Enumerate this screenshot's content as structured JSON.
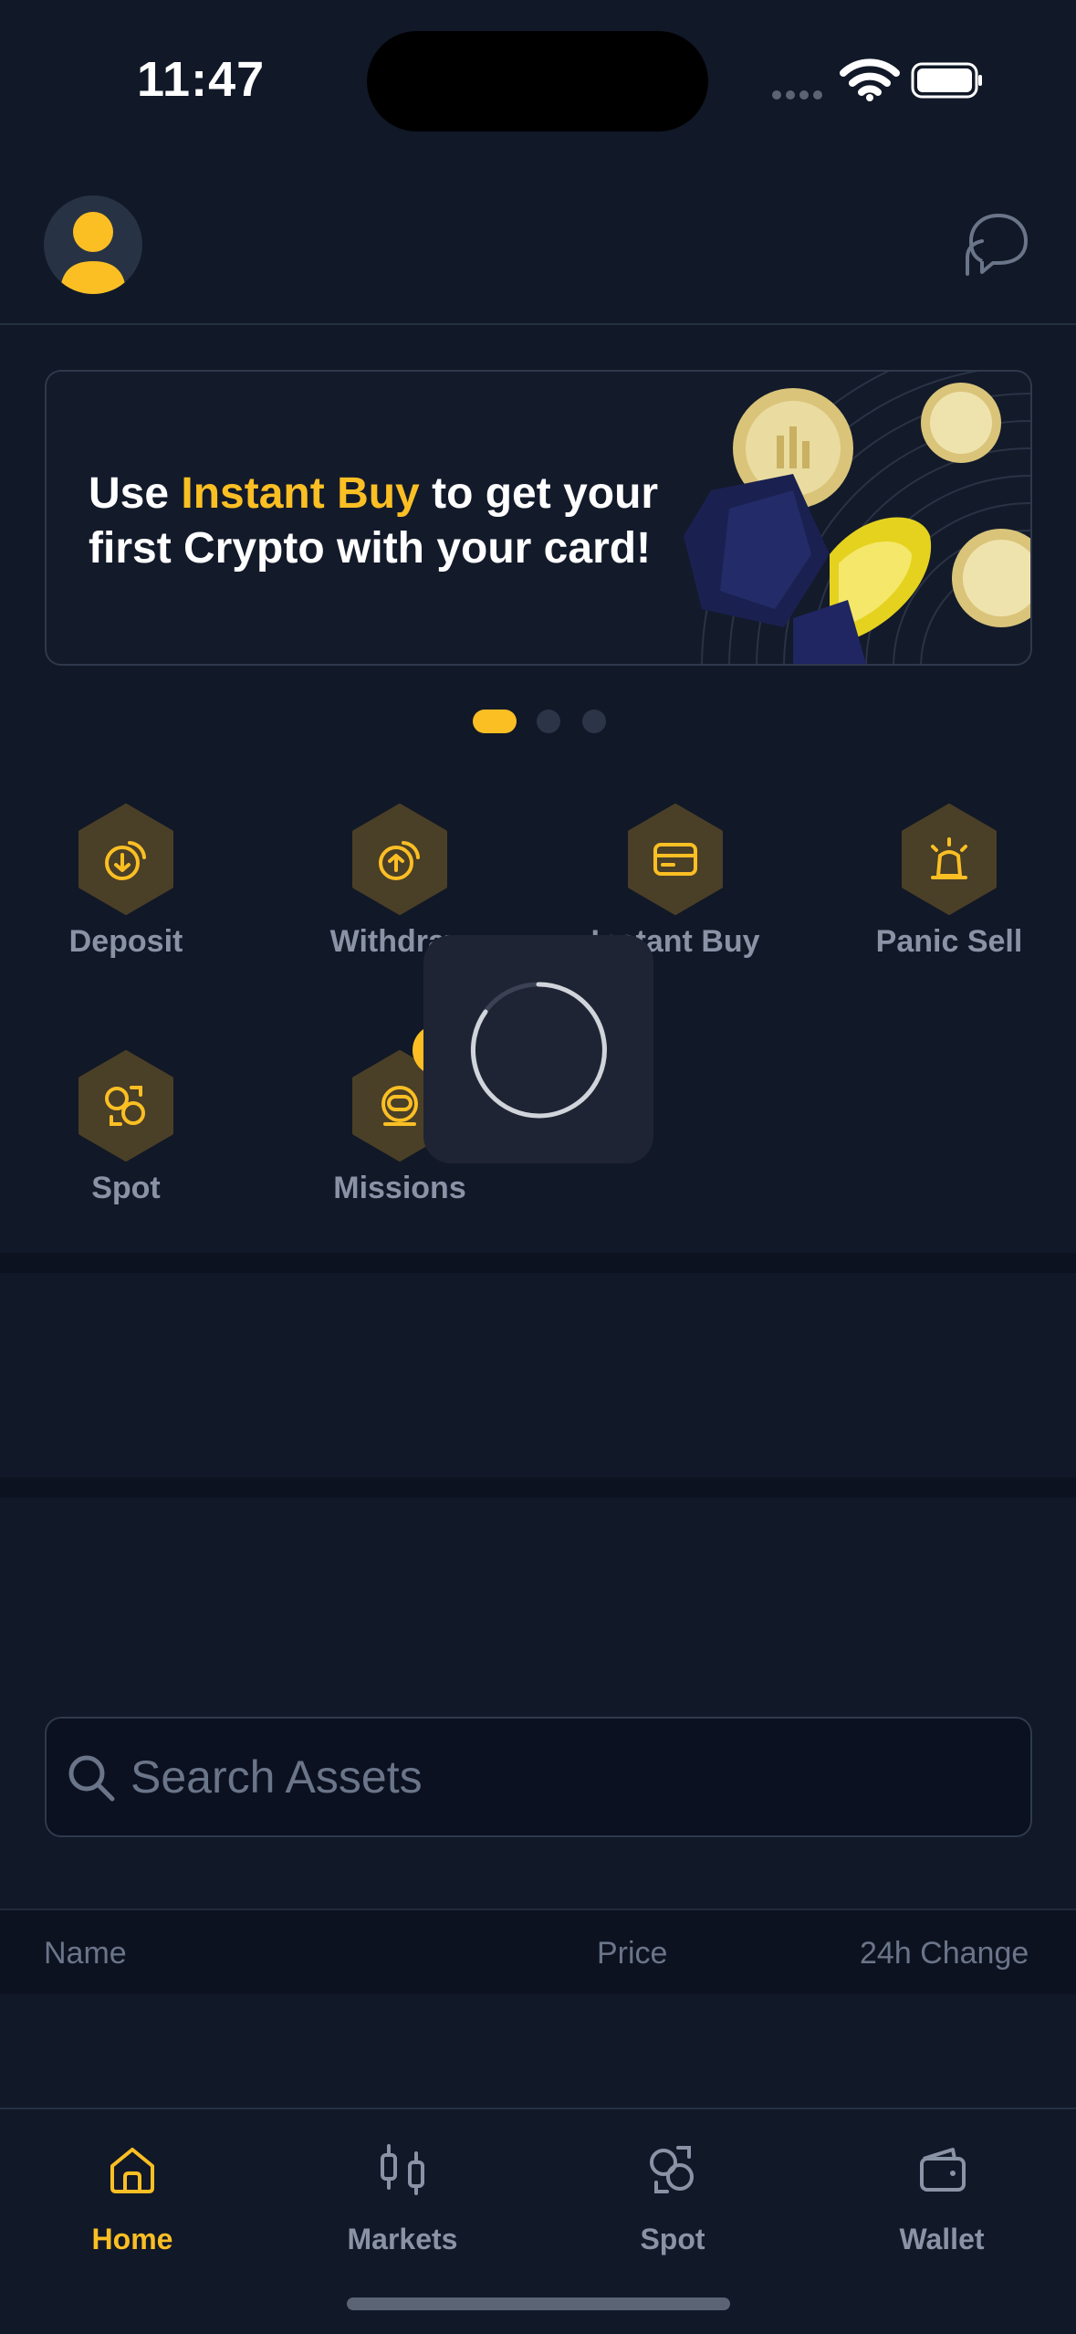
{
  "status_bar": {
    "time": "11:47"
  },
  "banner": {
    "text_before": "Use ",
    "highlight": "Instant Buy",
    "text_after": " to get your first Crypto with your card!",
    "slides_total": 3,
    "active_slide": 1
  },
  "actions": [
    {
      "label": "Deposit",
      "icon": "deposit-icon"
    },
    {
      "label": "Withdraw",
      "icon": "withdraw-icon"
    },
    {
      "label": "Instant Buy",
      "icon": "card-icon"
    },
    {
      "label": "Panic Sell",
      "icon": "siren-icon"
    },
    {
      "label": "Spot",
      "icon": "swap-icon"
    },
    {
      "label": "Missions",
      "icon": "astronaut-icon"
    }
  ],
  "search": {
    "placeholder": "Search Assets"
  },
  "table": {
    "col_name": "Name",
    "col_price": "Price",
    "col_change": "24h Change"
  },
  "tabs": [
    {
      "label": "Home",
      "icon": "home-icon",
      "active": true
    },
    {
      "label": "Markets",
      "icon": "candles-icon",
      "active": false
    },
    {
      "label": "Spot",
      "icon": "swap-icon",
      "active": false
    },
    {
      "label": "Wallet",
      "icon": "wallet-icon",
      "active": false
    }
  ],
  "colors": {
    "accent": "#fbbf24",
    "background": "#111827",
    "muted": "#8a93a6"
  }
}
